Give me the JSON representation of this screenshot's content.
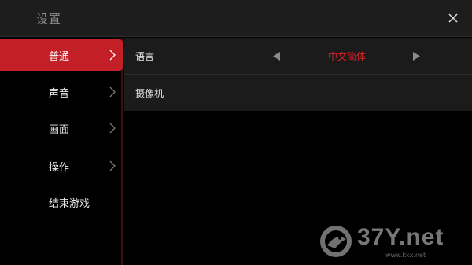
{
  "header": {
    "title": "设置"
  },
  "sidebar": {
    "items": [
      {
        "label": "普通",
        "active": true,
        "has_chevron": true
      },
      {
        "label": "声音",
        "active": false,
        "has_chevron": true
      },
      {
        "label": "画面",
        "active": false,
        "has_chevron": true
      },
      {
        "label": "操作",
        "active": false,
        "has_chevron": true
      },
      {
        "label": "结束游戏",
        "active": false,
        "has_chevron": false
      }
    ]
  },
  "content": {
    "language": {
      "label": "语言",
      "value": "中文简体"
    },
    "camera": {
      "label": "摄像机"
    }
  },
  "watermark": {
    "text": "37Y.net",
    "subtext": "www.kkx.net"
  },
  "colors": {
    "accent": "#c21f27",
    "value_text": "#d8232a",
    "header_bg": "#1d1d1d",
    "row_bg": "#1b1b1b"
  },
  "icons": {
    "close": "close-icon",
    "chevron": "chevron-right-icon",
    "prev": "triangle-left-icon",
    "next": "triangle-right-icon"
  }
}
